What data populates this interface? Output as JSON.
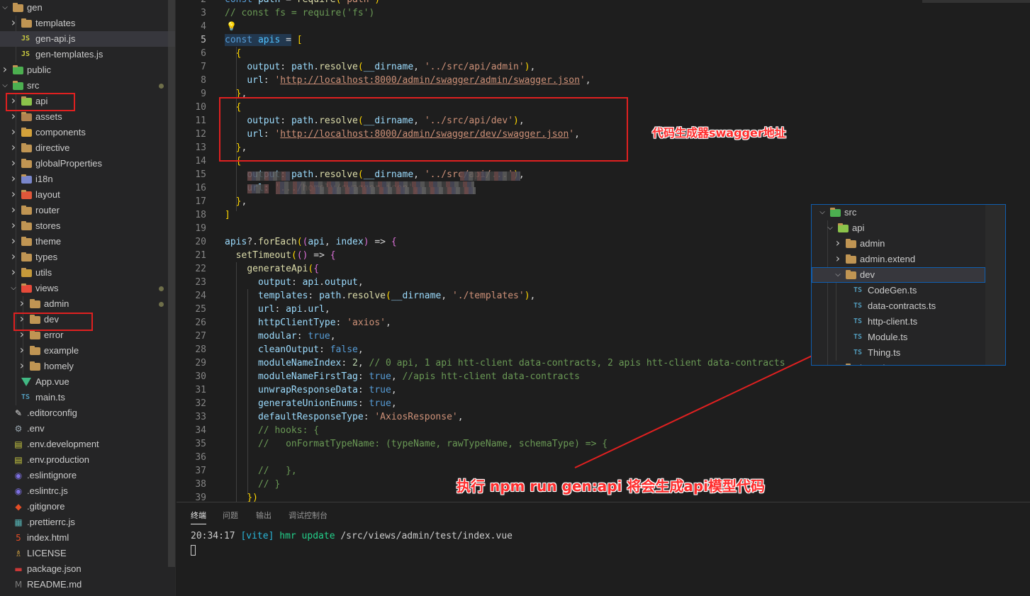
{
  "explorer": {
    "items": [
      {
        "label": "gen",
        "icon": "folder-open-icon",
        "chev": "down"
      },
      {
        "label": "templates",
        "icon": "folder-icon",
        "chev": "right"
      },
      {
        "label": "gen-api.js",
        "icon": "js-file-icon",
        "chev": ""
      },
      {
        "label": "gen-templates.js",
        "icon": "js-file-icon",
        "chev": ""
      },
      {
        "label": "public",
        "icon": "folder-public-icon",
        "chev": "right"
      },
      {
        "label": "src",
        "icon": "folder-src-icon",
        "chev": "down"
      },
      {
        "label": "api",
        "icon": "folder-api-icon",
        "chev": "right"
      },
      {
        "label": "assets",
        "icon": "folder-assets-icon",
        "chev": "right"
      },
      {
        "label": "components",
        "icon": "folder-components-icon",
        "chev": "right"
      },
      {
        "label": "directive",
        "icon": "folder-icon",
        "chev": "right"
      },
      {
        "label": "globalProperties",
        "icon": "folder-icon",
        "chev": "right"
      },
      {
        "label": "i18n",
        "icon": "folder-i18n-icon",
        "chev": "right"
      },
      {
        "label": "layout",
        "icon": "folder-layout-icon",
        "chev": "right"
      },
      {
        "label": "router",
        "icon": "folder-icon",
        "chev": "right"
      },
      {
        "label": "stores",
        "icon": "folder-icon",
        "chev": "right"
      },
      {
        "label": "theme",
        "icon": "folder-icon",
        "chev": "right"
      },
      {
        "label": "types",
        "icon": "folder-icon",
        "chev": "right"
      },
      {
        "label": "utils",
        "icon": "folder-utils-icon",
        "chev": "right"
      },
      {
        "label": "views",
        "icon": "folder-views-icon",
        "chev": "down"
      },
      {
        "label": "admin",
        "icon": "folder-icon",
        "chev": "right"
      },
      {
        "label": "dev",
        "icon": "folder-icon",
        "chev": "right"
      },
      {
        "label": "error",
        "icon": "folder-icon",
        "chev": "right"
      },
      {
        "label": "example",
        "icon": "folder-icon",
        "chev": "right"
      },
      {
        "label": "homely",
        "icon": "folder-icon",
        "chev": "right"
      },
      {
        "label": "App.vue",
        "icon": "vue-file-icon",
        "chev": ""
      },
      {
        "label": "main.ts",
        "icon": "ts-file-icon",
        "chev": ""
      },
      {
        "label": ".editorconfig",
        "icon": "editorconfig-icon",
        "chev": ""
      },
      {
        "label": ".env",
        "icon": "gear-icon",
        "chev": ""
      },
      {
        "label": ".env.development",
        "icon": "env-file-icon",
        "chev": ""
      },
      {
        "label": ".env.production",
        "icon": "env-file-icon",
        "chev": ""
      },
      {
        "label": ".eslintignore",
        "icon": "eslint-icon",
        "chev": ""
      },
      {
        "label": ".eslintrc.js",
        "icon": "eslint-icon",
        "chev": ""
      },
      {
        "label": ".gitignore",
        "icon": "git-icon",
        "chev": ""
      },
      {
        "label": ".prettierrc.js",
        "icon": "prettier-icon",
        "chev": ""
      },
      {
        "label": "index.html",
        "icon": "html-file-icon",
        "chev": ""
      },
      {
        "label": "LICENSE",
        "icon": "license-icon",
        "chev": ""
      },
      {
        "label": "package.json",
        "icon": "npm-icon",
        "chev": ""
      },
      {
        "label": "README.md",
        "icon": "markdown-icon",
        "chev": ""
      }
    ]
  },
  "editor": {
    "lines": [
      {
        "n": "2",
        "text": "const path = require('path')"
      },
      {
        "n": "3",
        "text": "// const fs = require('fs')"
      },
      {
        "n": "4",
        "text": ""
      },
      {
        "n": "5",
        "text": "const apis = ["
      },
      {
        "n": "6",
        "text": "  {"
      },
      {
        "n": "7",
        "text": "    output: path.resolve(__dirname, '../src/api/admin'),"
      },
      {
        "n": "8",
        "text": "    url: 'http://localhost:8000/admin/swagger/admin/swagger.json',"
      },
      {
        "n": "9",
        "text": "  },"
      },
      {
        "n": "10",
        "text": "  {"
      },
      {
        "n": "11",
        "text": "    output: path.resolve(__dirname, '../src/api/dev'),"
      },
      {
        "n": "12",
        "text": "    url: 'http://localhost:8000/admin/swagger/dev/swagger.json',"
      },
      {
        "n": "13",
        "text": "  },"
      },
      {
        "n": "14",
        "text": "  {"
      },
      {
        "n": "15",
        "text": "    output: path.resolve(__dirname, '../src/api/...'),"
      },
      {
        "n": "16",
        "text": "    url: '.../homely/swagger.json',"
      },
      {
        "n": "17",
        "text": "  },"
      },
      {
        "n": "18",
        "text": "]"
      },
      {
        "n": "19",
        "text": ""
      },
      {
        "n": "20",
        "text": "apis?.forEach((api, index) => {"
      },
      {
        "n": "21",
        "text": "  setTimeout(() => {"
      },
      {
        "n": "22",
        "text": "    generateApi({"
      },
      {
        "n": "23",
        "text": "      output: api.output,"
      },
      {
        "n": "24",
        "text": "      templates: path.resolve(__dirname, './templates'),"
      },
      {
        "n": "25",
        "text": "      url: api.url,"
      },
      {
        "n": "26",
        "text": "      httpClientType: 'axios',"
      },
      {
        "n": "27",
        "text": "      modular: true,"
      },
      {
        "n": "28",
        "text": "      cleanOutput: false,"
      },
      {
        "n": "29",
        "text": "      moduleNameIndex: 2, // 0 api, 1 api htt-client data-contracts, 2 apis htt-client data-contracts"
      },
      {
        "n": "30",
        "text": "      moduleNameFirstTag: true, //apis htt-client data-contracts"
      },
      {
        "n": "31",
        "text": "      unwrapResponseData: true,"
      },
      {
        "n": "32",
        "text": "      generateUnionEnums: true,"
      },
      {
        "n": "33",
        "text": "      defaultResponseType: 'AxiosResponse',"
      },
      {
        "n": "34",
        "text": "      // hooks: {"
      },
      {
        "n": "35",
        "text": "      //   onFormatTypeName: (typeName, rawTypeName, schemaType) => {"
      },
      {
        "n": "36",
        "text": ""
      },
      {
        "n": "37",
        "text": "      //   },"
      },
      {
        "n": "38",
        "text": "      // }"
      },
      {
        "n": "39",
        "text": "    })"
      }
    ]
  },
  "annotations": {
    "swagger_note": "代码生成器swagger地址",
    "npm_note": "执行 npm run gen:api 将会生成api模型代码",
    "box_color": "#e02020",
    "text_color": "#ff2d2d"
  },
  "inset_explorer": {
    "items": [
      {
        "label": "src",
        "icon": "folder-src-icon",
        "chev": "down"
      },
      {
        "label": "api",
        "icon": "folder-api-icon",
        "chev": "down"
      },
      {
        "label": "admin",
        "icon": "folder-icon",
        "chev": "right"
      },
      {
        "label": "admin.extend",
        "icon": "folder-icon",
        "chev": "right"
      },
      {
        "label": "dev",
        "icon": "folder-open-icon",
        "chev": "down"
      },
      {
        "label": "CodeGen.ts",
        "icon": "ts-file-icon",
        "chev": ""
      },
      {
        "label": "data-contracts.ts",
        "icon": "ts-file-icon",
        "chev": ""
      },
      {
        "label": "http-client.ts",
        "icon": "ts-file-icon",
        "chev": ""
      },
      {
        "label": "Module.ts",
        "icon": "ts-file-icon",
        "chev": ""
      },
      {
        "label": "Thing.ts",
        "icon": "ts-file-icon",
        "chev": ""
      },
      {
        "label": "homely",
        "icon": "folder-icon",
        "chev": "right"
      }
    ]
  },
  "panel": {
    "tabs": [
      "终端",
      "问题",
      "输出",
      "调试控制台"
    ],
    "active_tab": "终端",
    "terminal": {
      "time": "20:34:17",
      "tag": "[vite]",
      "action": "hmr update",
      "path": "/src/views/admin/test/index.vue"
    }
  }
}
